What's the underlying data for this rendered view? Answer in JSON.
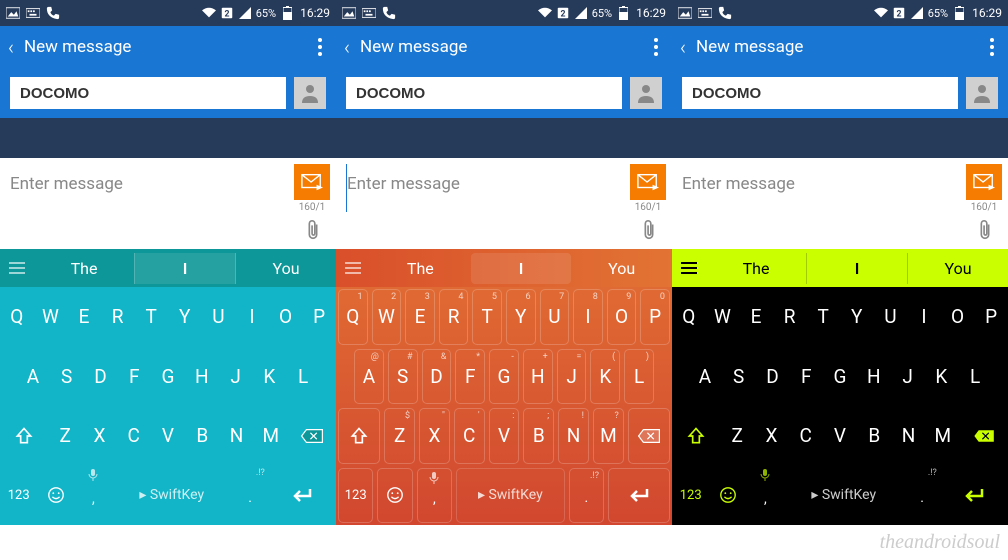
{
  "watermark": "theandroidsoul",
  "status": {
    "battery": "65%",
    "time": "16:29",
    "sim": "2"
  },
  "header": {
    "title": "New message"
  },
  "recipient": {
    "value": "DOCOMO"
  },
  "compose": {
    "placeholder": "Enter message",
    "char_count": "160/1"
  },
  "suggestions": {
    "left": "The",
    "mid": "I",
    "right": "You"
  },
  "keys": {
    "row1": [
      "Q",
      "W",
      "E",
      "R",
      "T",
      "Y",
      "U",
      "I",
      "O",
      "P"
    ],
    "row1_alt": [
      "1",
      "2",
      "3",
      "4",
      "5",
      "6",
      "7",
      "8",
      "9",
      "0"
    ],
    "row2": [
      "A",
      "S",
      "D",
      "F",
      "G",
      "H",
      "J",
      "K",
      "L"
    ],
    "row2_alt": [
      "@",
      "#",
      "&",
      "*",
      "-",
      "+",
      "=",
      "(",
      ")"
    ],
    "row3": [
      "Z",
      "X",
      "C",
      "V",
      "B",
      "N",
      "M"
    ],
    "row3_alt": [
      "_",
      "$",
      "\"",
      "'",
      ":",
      ";",
      "!",
      "?",
      "/"
    ],
    "num": "123",
    "space_label": "SwiftKey",
    "comma": ",",
    "period": ".",
    "period_alt": ".!?"
  }
}
